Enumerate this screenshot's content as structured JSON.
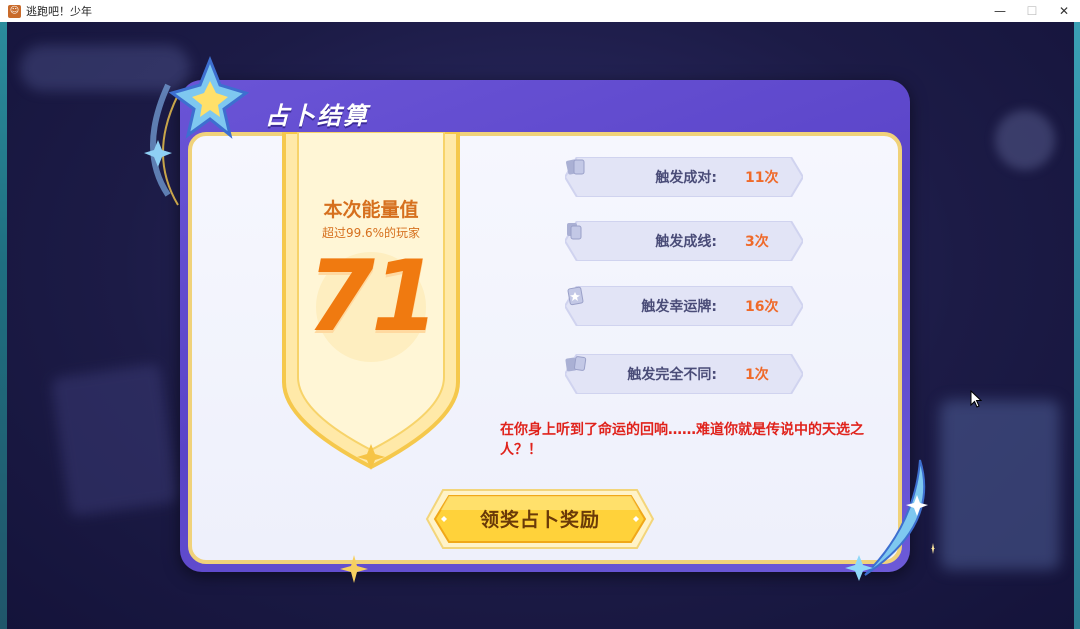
{
  "window": {
    "title": "逃跑吧！少年",
    "controls": {
      "minimize": "—",
      "maximize": "☐",
      "close": "✕"
    }
  },
  "dialog": {
    "title": "占卜结算",
    "energy": {
      "label": "本次能量值",
      "exceed_text": "超过99.6%的玩家",
      "score": "71"
    },
    "stats": [
      {
        "label": "触发成对:",
        "value": "11次",
        "icon": "pair-cards-icon"
      },
      {
        "label": "触发成线:",
        "value": "3次",
        "icon": "line-cards-icon"
      },
      {
        "label": "触发幸运牌:",
        "value": "16次",
        "icon": "lucky-card-icon"
      },
      {
        "label": "触发完全不同:",
        "value": "1次",
        "icon": "different-cards-icon"
      }
    ],
    "flavor_text": "在你身上听到了命运的回响……难道你就是传说中的天选之人？！",
    "claim_button": "领奖占卜奖励"
  },
  "colors": {
    "panel": "#5a44c8",
    "accent_orange": "#f07a10",
    "flavor_red": "#e0231c",
    "button_gold": "#ffd23a"
  }
}
